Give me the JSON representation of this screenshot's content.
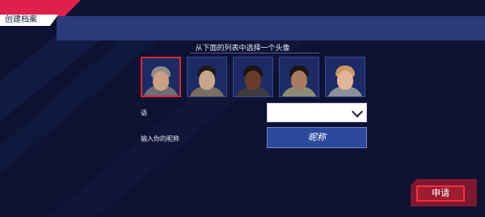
{
  "header": {
    "title": "创建档案"
  },
  "avatar_picker": {
    "prompt": "从下面的列表中选择一个头像",
    "avatars": [
      {
        "id": "avatar-1",
        "selected": true,
        "skin": "#c9a184",
        "hair": "#8f8a86",
        "shirt": "#6e6f76"
      },
      {
        "id": "avatar-2",
        "selected": false,
        "skin": "#c8a58a",
        "hair": "#1e1c1b",
        "shirt": "#7b6e63"
      },
      {
        "id": "avatar-3",
        "selected": false,
        "skin": "#6a3c28",
        "hair": "#1a1512",
        "shirt": "#3b3b40"
      },
      {
        "id": "avatar-4",
        "selected": false,
        "skin": "#a87a5e",
        "hair": "#1b1614",
        "shirt": "#8b8c76"
      },
      {
        "id": "avatar-5",
        "selected": false,
        "skin": "#e2b59a",
        "hair": "#c89862",
        "shirt": "#8a8f9a"
      }
    ]
  },
  "form": {
    "language_label": "语",
    "language_value": "",
    "nickname_label": "输入你的昵称",
    "nickname_button": "昵称"
  },
  "actions": {
    "apply_label": "申请"
  },
  "colors": {
    "accent_red": "#e0204a",
    "panel_blue": "#2b3a78",
    "background": "#0d1233"
  }
}
